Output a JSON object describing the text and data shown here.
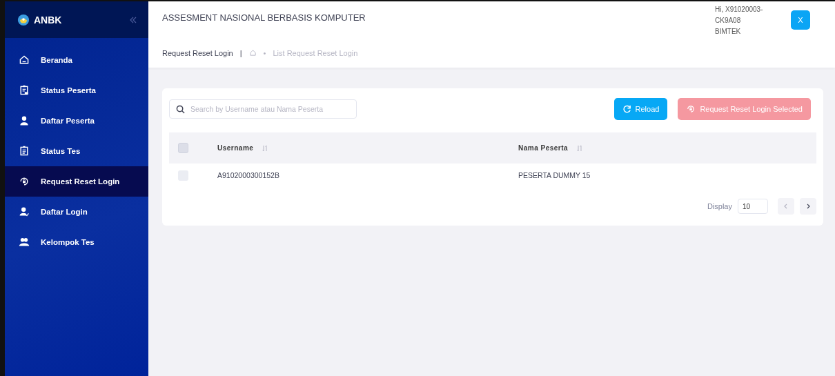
{
  "sidebar": {
    "brand": "ANBK",
    "items": [
      {
        "label": "Beranda",
        "selected": false
      },
      {
        "label": "Status Peserta",
        "selected": false
      },
      {
        "label": "Daftar Peserta",
        "selected": false
      },
      {
        "label": "Status Tes",
        "selected": false
      },
      {
        "label": "Request Reset Login",
        "selected": true
      },
      {
        "label": "Daftar Login",
        "selected": false
      },
      {
        "label": "Kelompok Tes",
        "selected": false
      }
    ]
  },
  "header": {
    "title": "ASSESMENT NASIONAL BERBASIS KOMPUTER",
    "user_lines": [
      "Hi, X91020003-",
      "CK9A08",
      "BIMTEK"
    ],
    "user_button": "X"
  },
  "breadcrumb": {
    "current": "Request Reset Login",
    "separator": "|",
    "bullet": "•",
    "trail": "List Request Reset Login"
  },
  "toolbar": {
    "search_placeholder": "Search by Username atau Nama Peserta",
    "reload": "Reload",
    "request": "Request Reset Login Selected",
    "request_disabled": true
  },
  "table": {
    "select_all_checked": false,
    "columns": [
      {
        "label": "Username"
      },
      {
        "label": "Nama Peserta"
      }
    ],
    "rows": [
      {
        "checked": false,
        "cells": [
          "A9102000300152B",
          "PESERTA DUMMY 15"
        ]
      }
    ]
  },
  "pagination": {
    "label": "Display",
    "page_size": "10"
  }
}
